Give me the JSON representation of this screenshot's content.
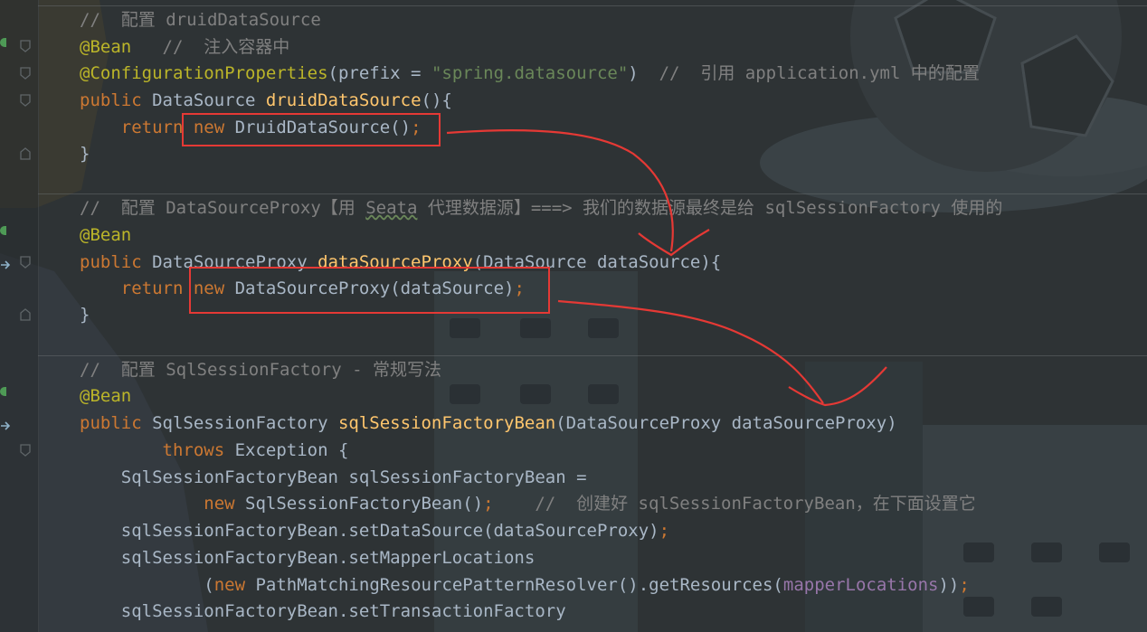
{
  "editor": {
    "lines": [
      [
        {
          "t": "//  配置 druidDataSource",
          "c": "cm"
        }
      ],
      [
        {
          "t": "@Bean",
          "c": "an"
        },
        {
          "t": "   //  注入容器中",
          "c": "cm"
        }
      ],
      [
        {
          "t": "@ConfigurationProperties",
          "c": "an"
        },
        {
          "t": "(prefix = ",
          "c": "df"
        },
        {
          "t": "\"spring.datasource\"",
          "c": "st"
        },
        {
          "t": ")  ",
          "c": "df"
        },
        {
          "t": "//  引用 application.yml 中的配置",
          "c": "cm"
        }
      ],
      [
        {
          "t": "public ",
          "c": "kw"
        },
        {
          "t": "DataSource ",
          "c": "df"
        },
        {
          "t": "druidDataSource",
          "c": "fn"
        },
        {
          "t": "(){",
          "c": "df"
        }
      ],
      [
        {
          "t": "    return ",
          "c": "kw"
        },
        {
          "t": "new ",
          "c": "kw"
        },
        {
          "t": "DruidDataSource()",
          "c": "df"
        },
        {
          "t": ";",
          "c": "kw"
        }
      ],
      [
        {
          "t": "}",
          "c": "df"
        }
      ],
      [
        {
          "t": "//  配置 DataSourceProxy【用 ",
          "c": "cm"
        },
        {
          "t": "Seata",
          "c": "cm ul"
        },
        {
          "t": " 代理数据源】===> 我们的数据源最终是给 sqlSessionFactory 使用的",
          "c": "cm"
        }
      ],
      [
        {
          "t": "@Bean",
          "c": "an"
        }
      ],
      [
        {
          "t": "public ",
          "c": "kw"
        },
        {
          "t": "DataSourceProxy ",
          "c": "df"
        },
        {
          "t": "dataSourceProxy",
          "c": "fn"
        },
        {
          "t": "(DataSource dataSource){",
          "c": "df"
        }
      ],
      [
        {
          "t": "    return ",
          "c": "kw"
        },
        {
          "t": "new ",
          "c": "kw"
        },
        {
          "t": "DataSourceProxy(dataSource)",
          "c": "df"
        },
        {
          "t": ";",
          "c": "kw"
        }
      ],
      [
        {
          "t": "}",
          "c": "df"
        }
      ],
      [
        {
          "t": "//  配置 SqlSessionFactory - 常规写法",
          "c": "cm"
        }
      ],
      [
        {
          "t": "@Bean",
          "c": "an"
        }
      ],
      [
        {
          "t": "public ",
          "c": "kw"
        },
        {
          "t": "SqlSessionFactory ",
          "c": "df"
        },
        {
          "t": "sqlSessionFactoryBean",
          "c": "fn"
        },
        {
          "t": "(DataSourceProxy dataSourceProxy)",
          "c": "df"
        }
      ],
      [
        {
          "t": "        throws ",
          "c": "kw"
        },
        {
          "t": "Exception {",
          "c": "df"
        }
      ],
      [
        {
          "t": "    SqlSessionFactoryBean sqlSessionFactoryBean =",
          "c": "df"
        }
      ],
      [
        {
          "t": "            new ",
          "c": "kw"
        },
        {
          "t": "SqlSessionFactoryBean()",
          "c": "df"
        },
        {
          "t": ";    ",
          "c": "kw"
        },
        {
          "t": "//  创建好 sqlSessionFactoryBean，在下面设置它",
          "c": "cm"
        }
      ],
      [
        {
          "t": "    sqlSessionFactoryBean.setDataSource(dataSourceProxy)",
          "c": "df"
        },
        {
          "t": ";",
          "c": "kw"
        }
      ],
      [
        {
          "t": "    sqlSessionFactoryBean.setMapperLocations",
          "c": "df"
        }
      ],
      [
        {
          "t": "            (",
          "c": "df"
        },
        {
          "t": "new ",
          "c": "kw"
        },
        {
          "t": "PathMatchingResourcePatternResolver().getResources(",
          "c": "df"
        },
        {
          "t": "mapperLocations",
          "c": "fd"
        },
        {
          "t": "))",
          "c": "df"
        },
        {
          "t": ";",
          "c": "kw"
        }
      ],
      [
        {
          "t": "    sqlSessionFactoryBean.setTransactionFactory",
          "c": "df"
        }
      ]
    ]
  },
  "colors": {
    "comment": "#808080",
    "keyword": "#cc7832",
    "annotation": "#bbb529",
    "string": "#6a8759",
    "method": "#ffc66d",
    "field": "#9876aa",
    "default_text": "#a9b7c6",
    "highlight_box": "#e53935"
  }
}
